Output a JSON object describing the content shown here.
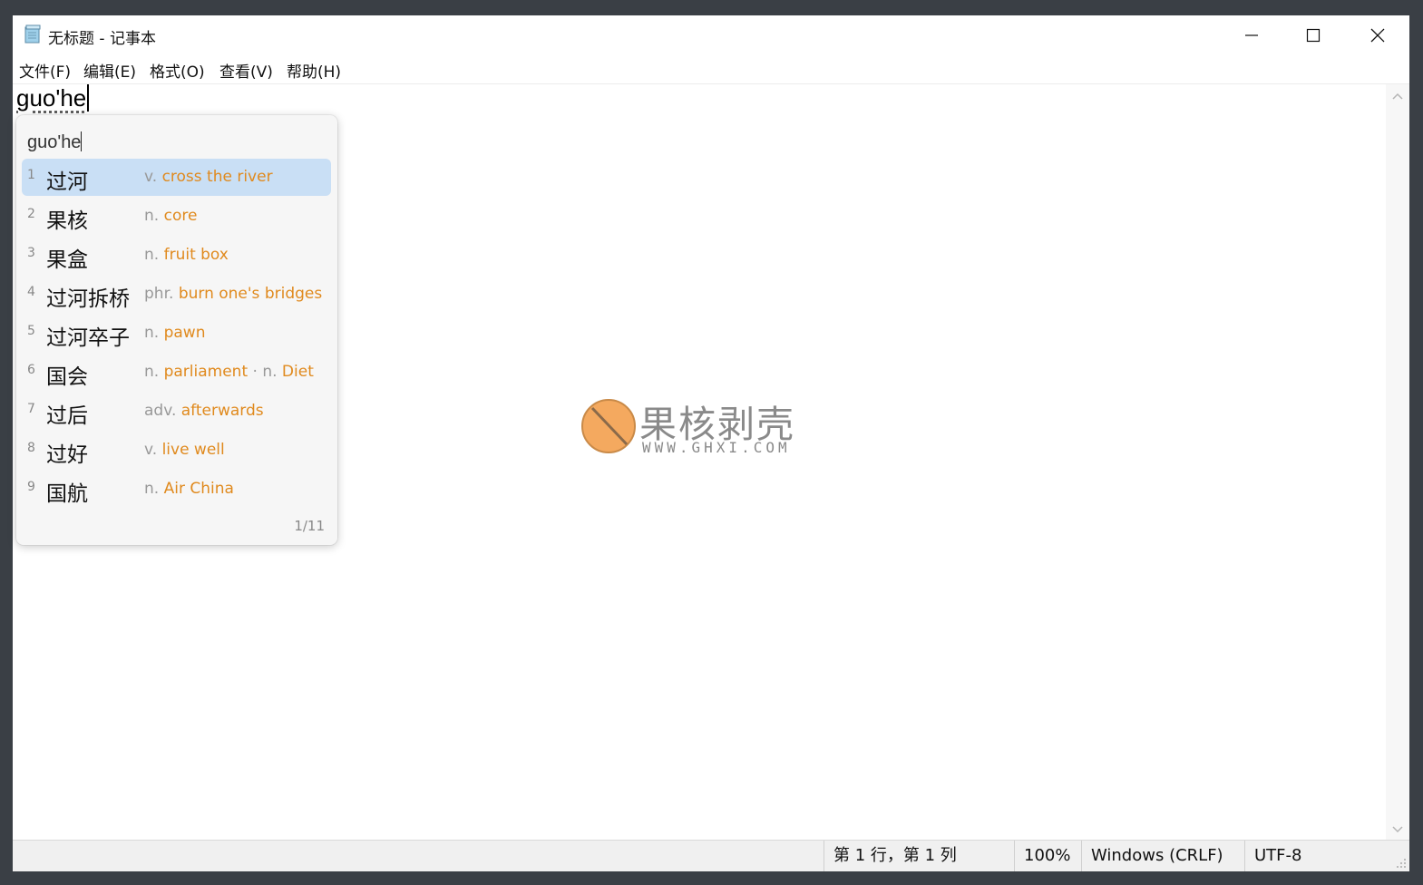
{
  "window": {
    "title": "无标题 - 记事本",
    "controls": {
      "minimize": "minimize-icon",
      "maximize": "maximize-icon",
      "close": "close-icon"
    }
  },
  "menu": [
    "文件(F)",
    "编辑(E)",
    "格式(O)",
    "查看(V)",
    "帮助(H)"
  ],
  "editor": {
    "text": "guo'he"
  },
  "ime": {
    "composition": "guo'he",
    "page_indicator": "1/11",
    "selected_index": 1,
    "candidates": [
      {
        "num": "1",
        "word": "过河",
        "pos": "v.",
        "meaning": "cross the river",
        "pos2": "",
        "meaning2": ""
      },
      {
        "num": "2",
        "word": "果核",
        "pos": "n.",
        "meaning": "core",
        "pos2": "",
        "meaning2": ""
      },
      {
        "num": "3",
        "word": "果盒",
        "pos": "n.",
        "meaning": "fruit box",
        "pos2": "",
        "meaning2": ""
      },
      {
        "num": "4",
        "word": "过河拆桥",
        "pos": "phr.",
        "meaning": "burn one's bridges",
        "pos2": "",
        "meaning2": ""
      },
      {
        "num": "5",
        "word": "过河卒子",
        "pos": "n.",
        "meaning": "pawn",
        "pos2": "",
        "meaning2": ""
      },
      {
        "num": "6",
        "word": "国会",
        "pos": "n.",
        "meaning": "parliament",
        "pos2": " · n.",
        "meaning2": "Diet"
      },
      {
        "num": "7",
        "word": "过后",
        "pos": "adv.",
        "meaning": "afterwards",
        "pos2": "",
        "meaning2": ""
      },
      {
        "num": "8",
        "word": "过好",
        "pos": "v.",
        "meaning": "live well",
        "pos2": "",
        "meaning2": ""
      },
      {
        "num": "9",
        "word": "国航",
        "pos": "n.",
        "meaning": "Air China",
        "pos2": "",
        "meaning2": ""
      }
    ]
  },
  "watermark": {
    "brand": "果核剥壳",
    "url": "WWW.GHXI.COM"
  },
  "statusbar": {
    "position": "第 1 行，第 1 列",
    "zoom": "100%",
    "line_ending": "Windows (CRLF)",
    "encoding": "UTF-8"
  },
  "colors": {
    "selected_candidate": "#c9dff5",
    "meaning_text": "#e08a1e",
    "pos_text": "#999999",
    "watermark_orange": "#f4a95f"
  }
}
